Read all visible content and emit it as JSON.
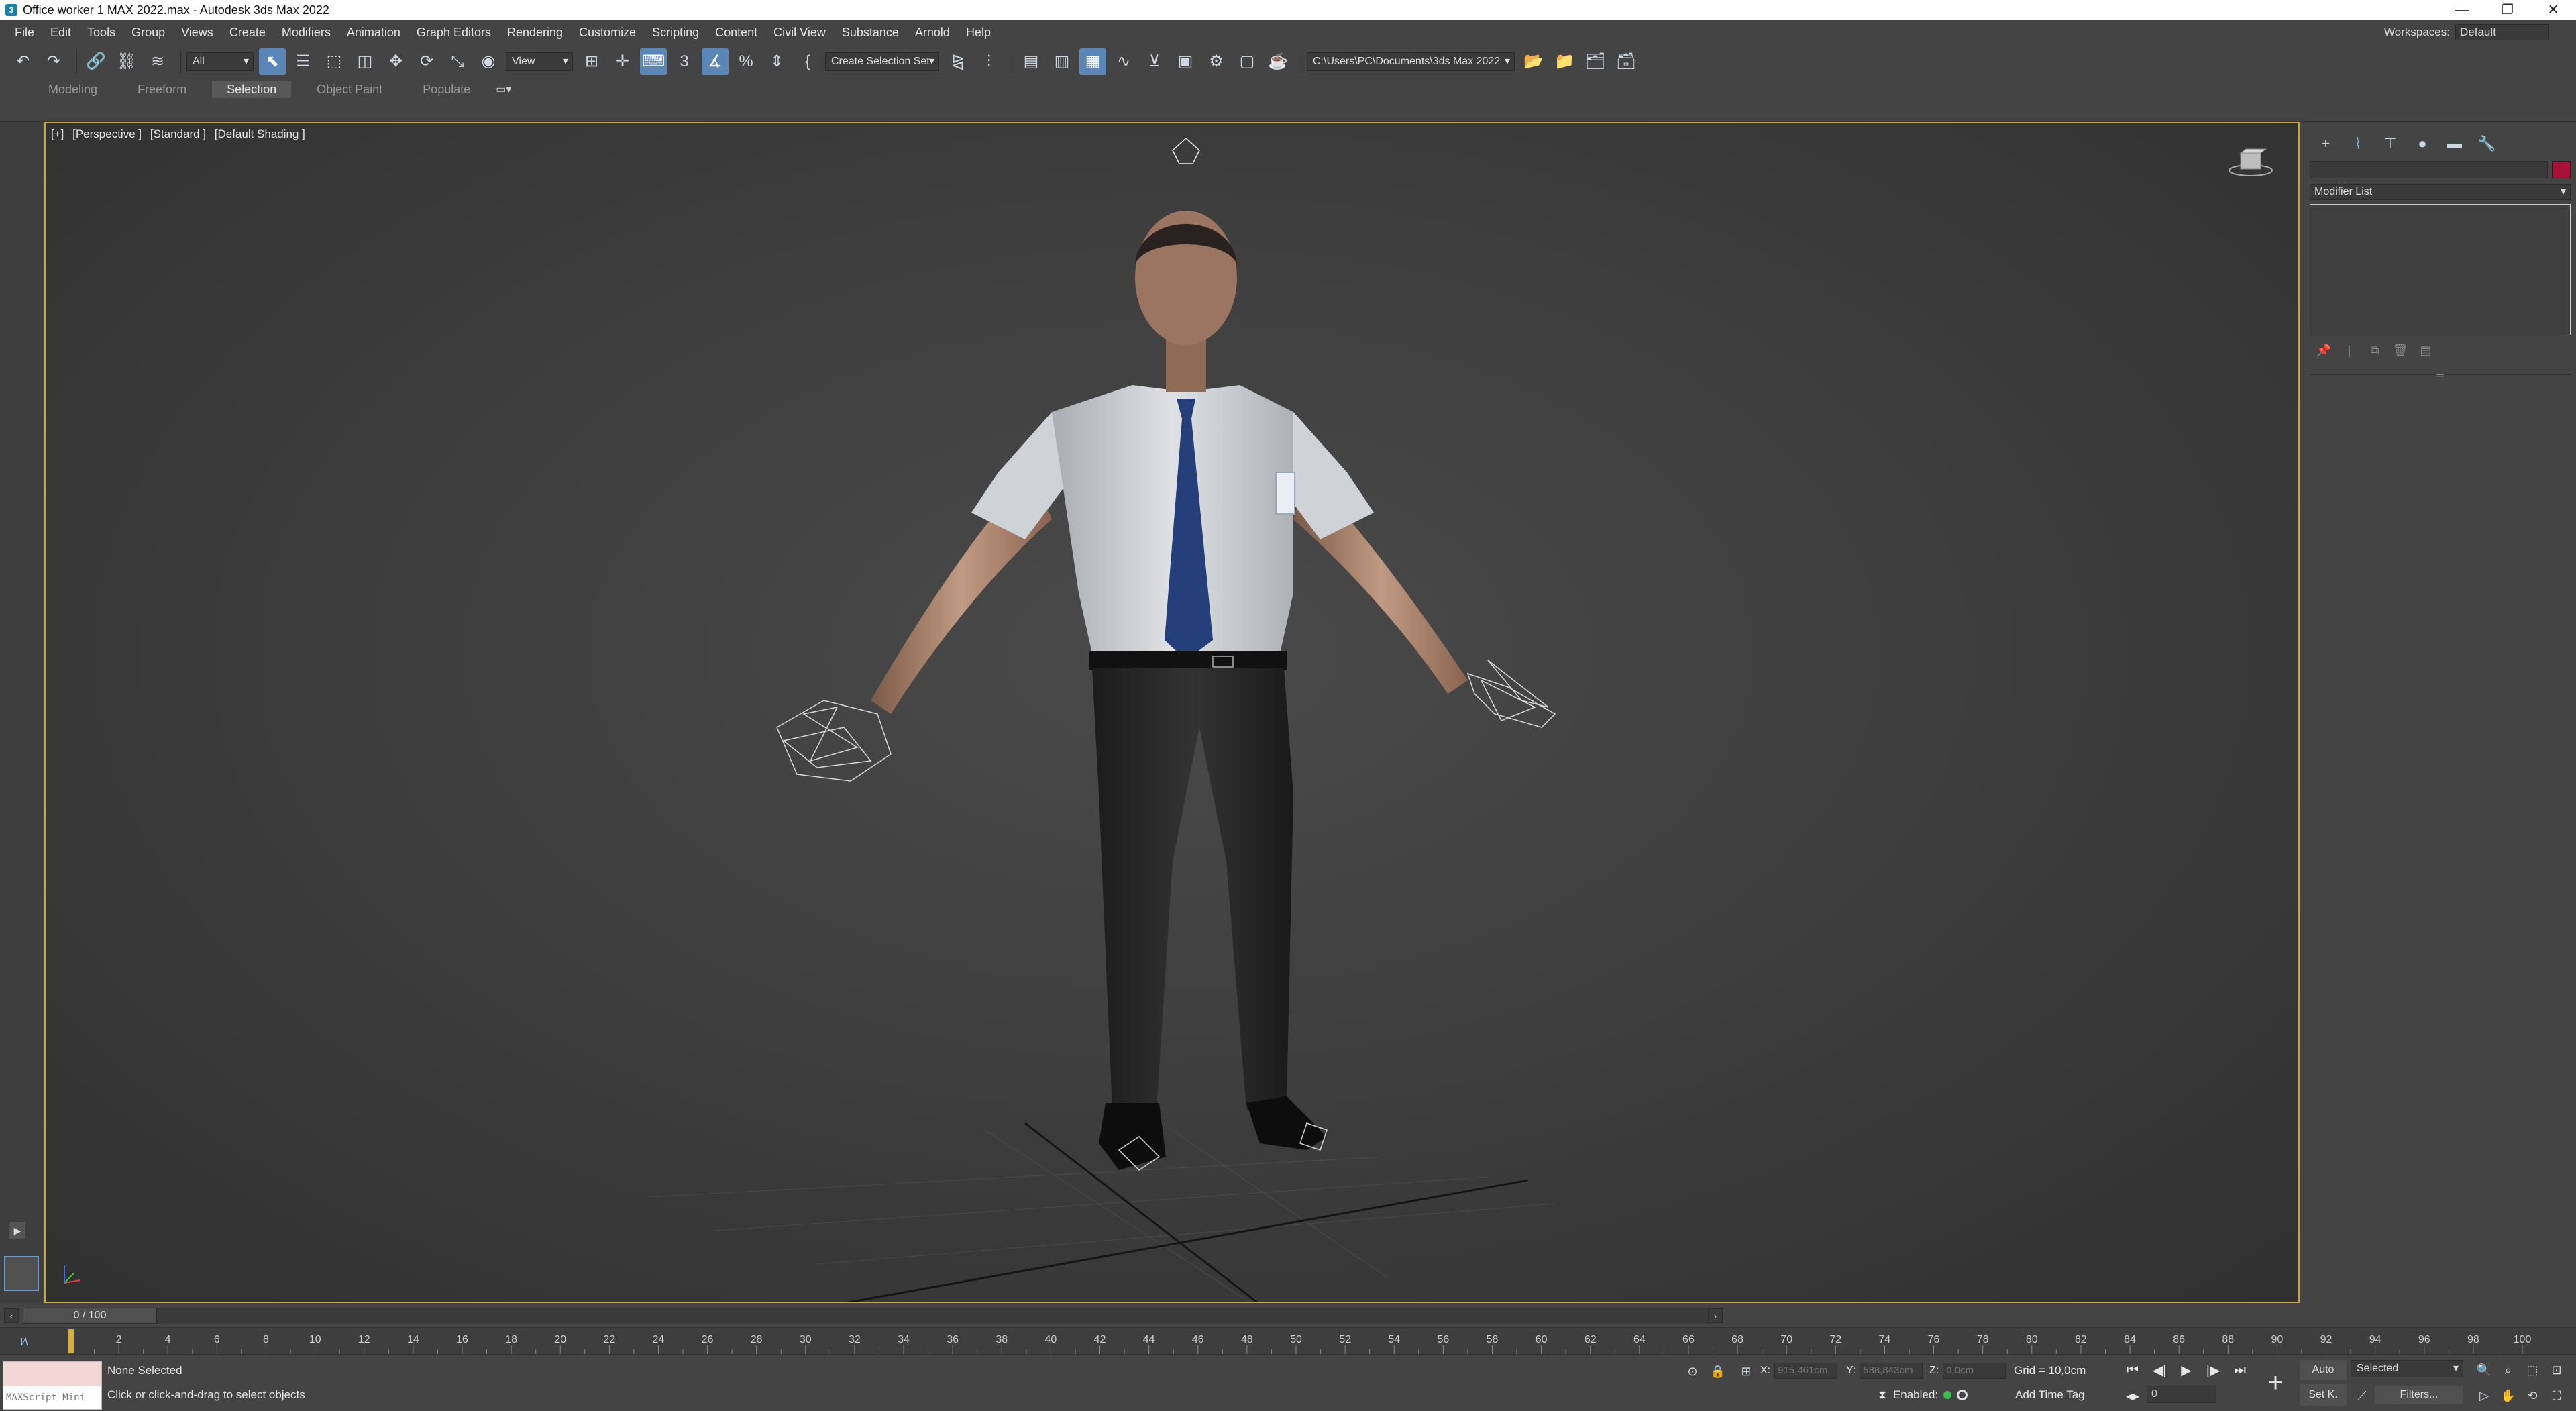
{
  "window": {
    "title": "Office worker 1 MAX 2022.max - Autodesk 3ds Max 2022",
    "app_icon": "3ds-max-icon",
    "controls": [
      "minimize",
      "restore",
      "close"
    ]
  },
  "menu": {
    "items": [
      "File",
      "Edit",
      "Tools",
      "Group",
      "Views",
      "Create",
      "Modifiers",
      "Animation",
      "Graph Editors",
      "Rendering",
      "Customize",
      "Scripting",
      "Content",
      "Civil View",
      "Substance",
      "Arnold",
      "Help"
    ],
    "workspaces_label": "Workspaces:",
    "workspaces_value": "Default"
  },
  "toolbar": {
    "filter_value": "All",
    "view_value": "View",
    "selection_set_value": "Create Selection Set",
    "path_value": "C:\\Users\\PC\\Documents\\3ds Max 2022"
  },
  "ribbon": {
    "tabs": [
      "Modeling",
      "Freeform",
      "Selection",
      "Object Paint",
      "Populate"
    ],
    "active_tab": "Selection"
  },
  "viewport": {
    "label_plus": "[+]",
    "label_view": "[Perspective ]",
    "label_standard": "[Standard ]",
    "label_shading": "[Default Shading ]",
    "border_color": "#c9a83a"
  },
  "command_panel": {
    "tabs": [
      "create-icon",
      "modify-icon",
      "hierarchy-icon",
      "motion-icon",
      "display-icon",
      "utilities-icon"
    ],
    "active_tab": "modify-icon",
    "modifier_list": "Modifier List",
    "object_color": "#a8103a"
  },
  "time_slider": {
    "value": "0 / 100"
  },
  "timeline": {
    "ticks": [
      0,
      2,
      4,
      6,
      8,
      10,
      12,
      14,
      16,
      18,
      20,
      22,
      24,
      26,
      28,
      30,
      32,
      34,
      36,
      38,
      40,
      42,
      44,
      46,
      48,
      50,
      52,
      54,
      56,
      58,
      60,
      62,
      64,
      66,
      68,
      70,
      72,
      74,
      76,
      78,
      80,
      82,
      84,
      86,
      88,
      90,
      92,
      94,
      96,
      98,
      100
    ],
    "labeled_ticks": [
      "2",
      "4",
      "6",
      "8",
      "10",
      "12",
      "14",
      "16",
      "18",
      "20",
      "22",
      "24",
      "26",
      "28",
      "30",
      "32",
      "34",
      "36",
      "38",
      "40",
      "42",
      "44",
      "46",
      "48",
      "50",
      "52",
      "54",
      "56",
      "58",
      "60",
      "62",
      "64",
      "66",
      "68",
      "70",
      "72",
      "74",
      "76",
      "78",
      "80",
      "82",
      "84",
      "86",
      "88",
      "90",
      "92",
      "94",
      "96",
      "98",
      "100"
    ]
  },
  "status": {
    "maxscript_placeholder": "MAXScript Mini",
    "selection": "None Selected",
    "prompt": "Click or click-and-drag to select objects",
    "x_label": "X:",
    "x_value": "915,461cm",
    "y_label": "Y:",
    "y_value": "588,843cm",
    "z_label": "Z:",
    "z_value": "0,0cm",
    "grid": "Grid = 10,0cm",
    "enabled_label": "Enabled:",
    "add_time_tag": "Add Time Tag",
    "auto_label": "Auto",
    "set_key_label": "Set K.",
    "selected_value": "Selected",
    "filters_label": "Filters...",
    "frame_value": "0"
  }
}
